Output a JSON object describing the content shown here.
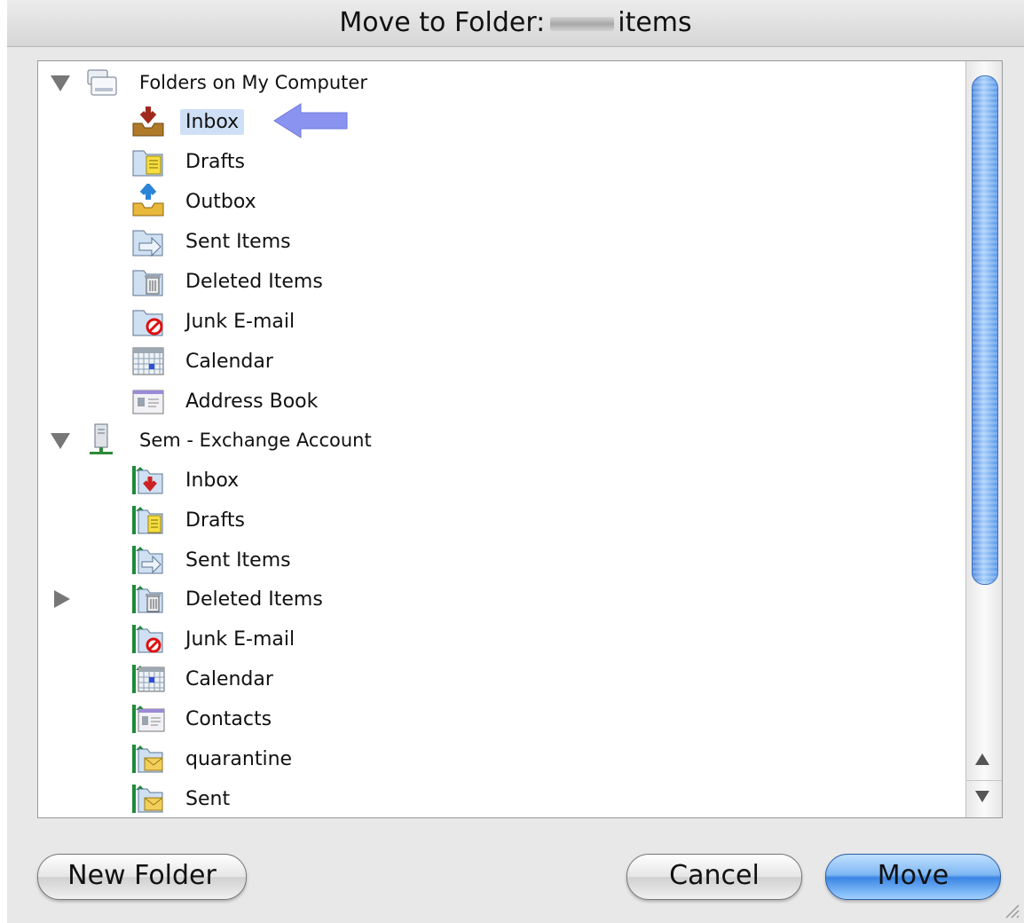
{
  "window": {
    "title_prefix": "Move to Folder:",
    "title_suffix": "items"
  },
  "tree": {
    "groups": [
      {
        "label": "Folders on My Computer",
        "expanded": true,
        "items": [
          {
            "label": "Inbox",
            "icon": "inbox-tray-icon",
            "selected": true
          },
          {
            "label": "Drafts",
            "icon": "drafts-folder-icon"
          },
          {
            "label": "Outbox",
            "icon": "outbox-tray-icon"
          },
          {
            "label": "Sent Items",
            "icon": "sent-folder-icon"
          },
          {
            "label": "Deleted Items",
            "icon": "trash-folder-icon"
          },
          {
            "label": "Junk E-mail",
            "icon": "junk-folder-icon"
          },
          {
            "label": "Calendar",
            "icon": "calendar-icon"
          },
          {
            "label": "Address Book",
            "icon": "address-book-icon"
          }
        ]
      },
      {
        "label": "Sem - Exchange Account",
        "expanded": true,
        "items": [
          {
            "label": "Inbox",
            "icon": "exchange-inbox-icon"
          },
          {
            "label": "Drafts",
            "icon": "exchange-drafts-icon"
          },
          {
            "label": "Sent Items",
            "icon": "exchange-sent-icon"
          },
          {
            "label": "Deleted Items",
            "icon": "exchange-trash-icon",
            "has_children": true
          },
          {
            "label": "Junk E-mail",
            "icon": "exchange-junk-icon"
          },
          {
            "label": "Calendar",
            "icon": "exchange-calendar-icon"
          },
          {
            "label": "Contacts",
            "icon": "exchange-contacts-icon"
          },
          {
            "label": "quarantine",
            "icon": "exchange-mail-folder-icon"
          },
          {
            "label": "Sent",
            "icon": "exchange-mail-folder-icon"
          }
        ]
      }
    ]
  },
  "buttons": {
    "new_folder": "New Folder",
    "cancel": "Cancel",
    "move": "Move"
  },
  "colors": {
    "accent": "#3a86e4",
    "selection": "#cfe0f6",
    "indicator_arrow": "#8a93f0"
  }
}
